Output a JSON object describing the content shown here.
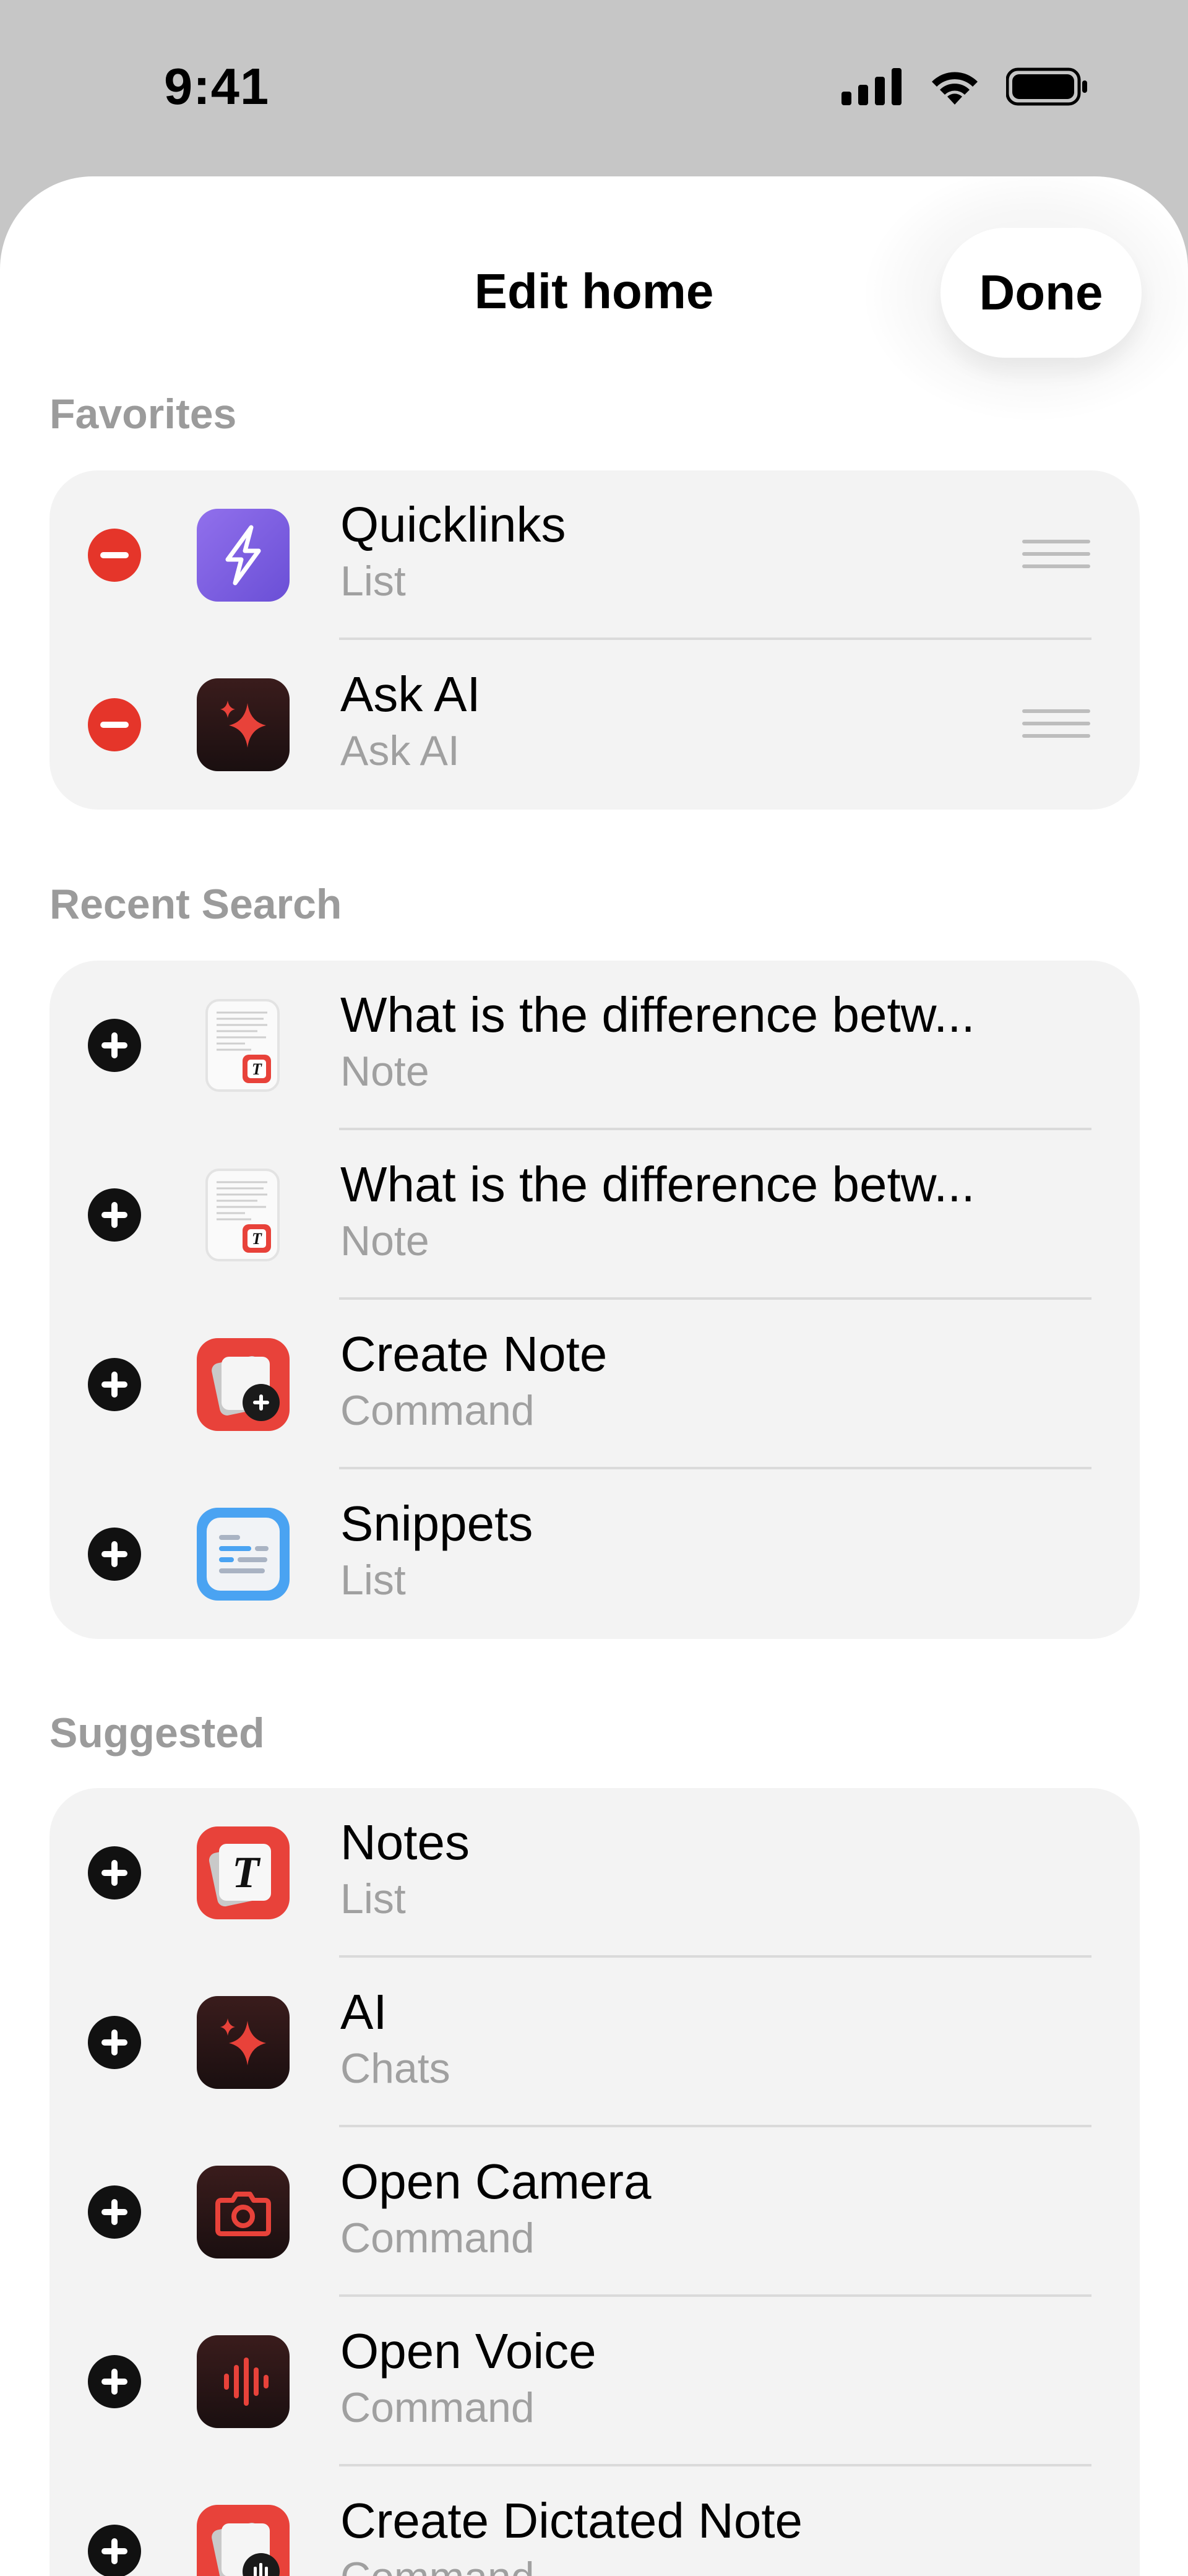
{
  "status_bar": {
    "time": "9:41"
  },
  "header": {
    "title": "Edit home",
    "done_label": "Done"
  },
  "favorites": {
    "title": "Favorites",
    "items": [
      {
        "name": "Quicklinks",
        "subtitle": "List",
        "icon": "quicklinks-icon"
      },
      {
        "name": "Ask AI",
        "subtitle": "Ask AI",
        "icon": "ai-sparkle-icon"
      }
    ]
  },
  "recent_search": {
    "title": "Recent Search",
    "items": [
      {
        "name": "What is the difference betw...",
        "subtitle": "Note",
        "icon": "note-document-icon"
      },
      {
        "name": "What is the difference betw...",
        "subtitle": "Note",
        "icon": "note-document-icon"
      },
      {
        "name": "Create Note",
        "subtitle": "Command",
        "icon": "create-note-icon"
      },
      {
        "name": "Snippets",
        "subtitle": "List",
        "icon": "snippets-icon"
      }
    ]
  },
  "suggested": {
    "title": "Suggested",
    "items": [
      {
        "name": "Notes",
        "subtitle": "List",
        "icon": "notes-icon"
      },
      {
        "name": "AI",
        "subtitle": "Chats",
        "icon": "ai-sparkle-icon"
      },
      {
        "name": "Open Camera",
        "subtitle": "Command",
        "icon": "camera-icon"
      },
      {
        "name": "Open Voice",
        "subtitle": "Command",
        "icon": "voice-icon"
      },
      {
        "name": "Create Dictated Note",
        "subtitle": "Command",
        "icon": "dictated-note-icon"
      }
    ]
  },
  "colors": {
    "remove": "#e5352a",
    "add": "#111111",
    "group_bg": "#f3f3f3",
    "section_title": "#9b9b9b",
    "accent_red": "#e8423a",
    "quicklinks_purple": "#7b5ce0",
    "snippets_blue": "#4aa3f2"
  }
}
